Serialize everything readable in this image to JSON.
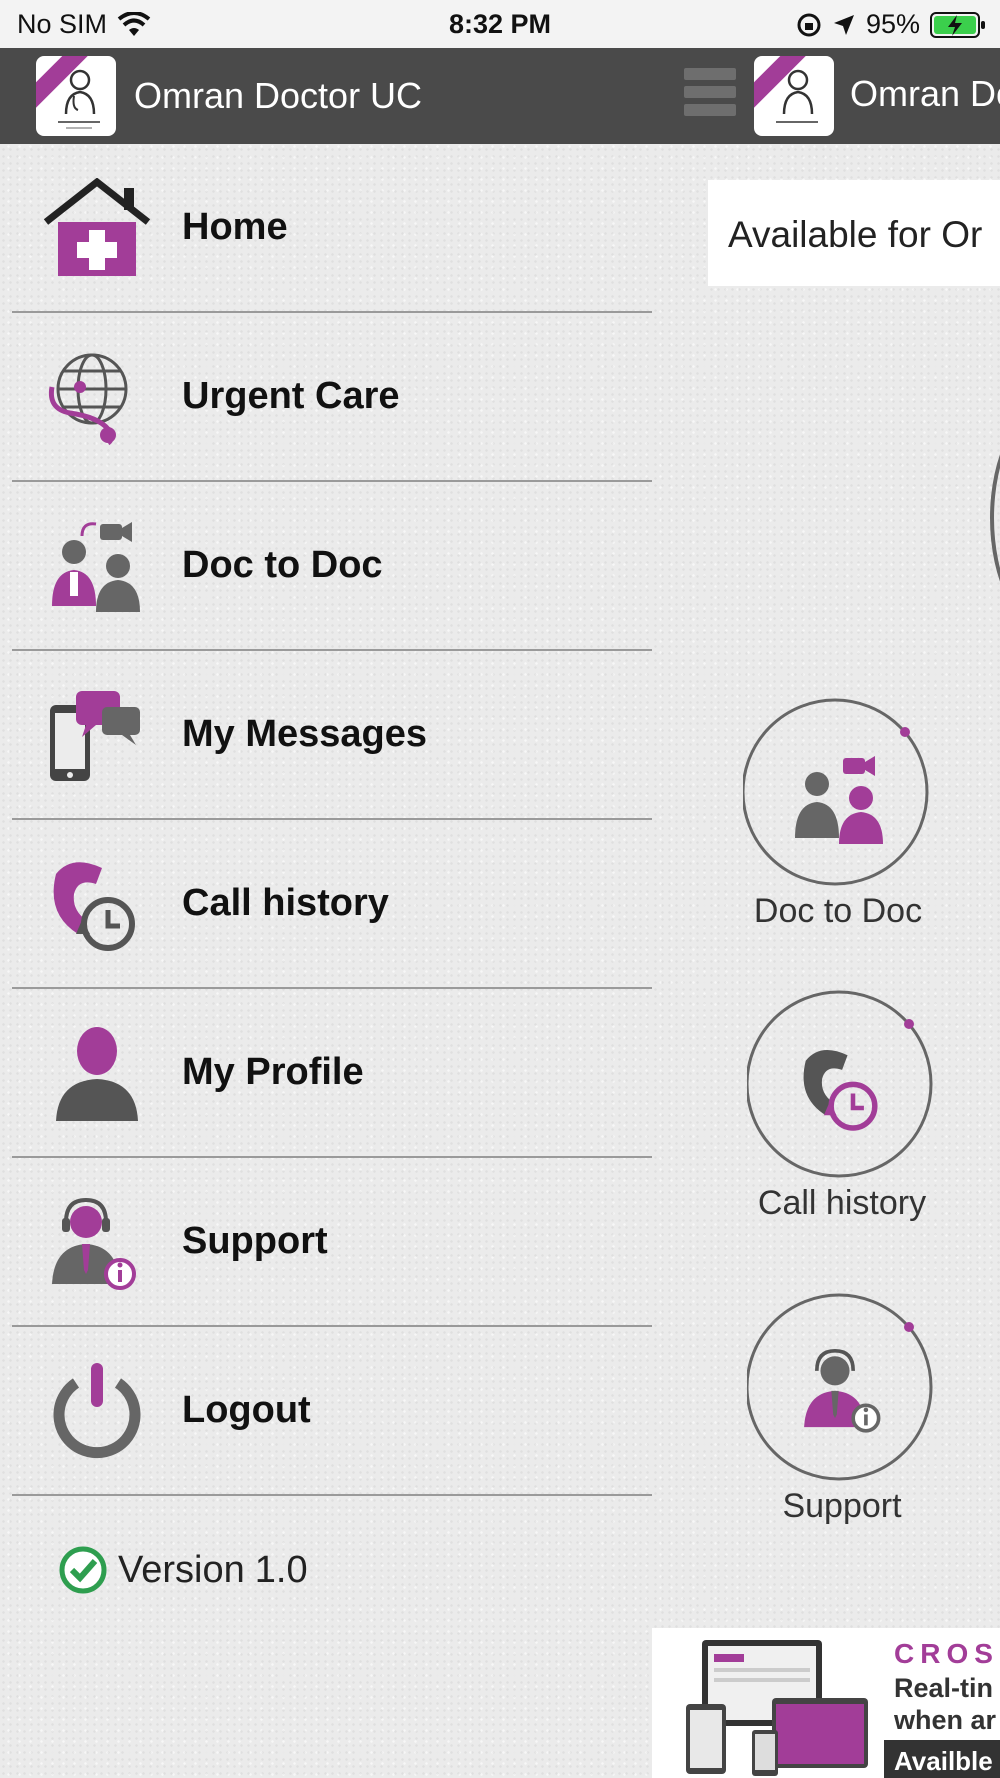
{
  "status_bar": {
    "carrier": "No SIM",
    "time": "8:32 PM",
    "battery": "95%"
  },
  "drawer": {
    "title": "Omran Doctor UC",
    "items": [
      {
        "label": "Home",
        "icon": "home-medical-icon"
      },
      {
        "label": "Urgent Care",
        "icon": "globe-stethoscope-icon"
      },
      {
        "label": "Doc to Doc",
        "icon": "doctors-video-icon"
      },
      {
        "label": "My Messages",
        "icon": "phone-chat-icon"
      },
      {
        "label": "Call history",
        "icon": "call-history-icon"
      },
      {
        "label": "My Profile",
        "icon": "user-profile-icon"
      },
      {
        "label": "Support",
        "icon": "support-agent-icon"
      },
      {
        "label": "Logout",
        "icon": "power-icon"
      }
    ],
    "version_label": "Version",
    "version_value": "1.0"
  },
  "main": {
    "title": "Omran Do",
    "availability_text": "Available for Or",
    "features": [
      {
        "label": "Doc to Doc",
        "icon": "doctors-video-icon"
      },
      {
        "label": "Call history",
        "icon": "call-history-icon"
      },
      {
        "label": "Support",
        "icon": "support-agent-icon"
      }
    ],
    "ad": {
      "headline": "CROS",
      "line1": "Real-tin",
      "line2": "when ar",
      "badge": "Availble"
    }
  },
  "colors": {
    "accent": "#a23d98",
    "header": "#4a4a4a",
    "icon_gray": "#666666",
    "version_check": "#2e9e4f"
  }
}
